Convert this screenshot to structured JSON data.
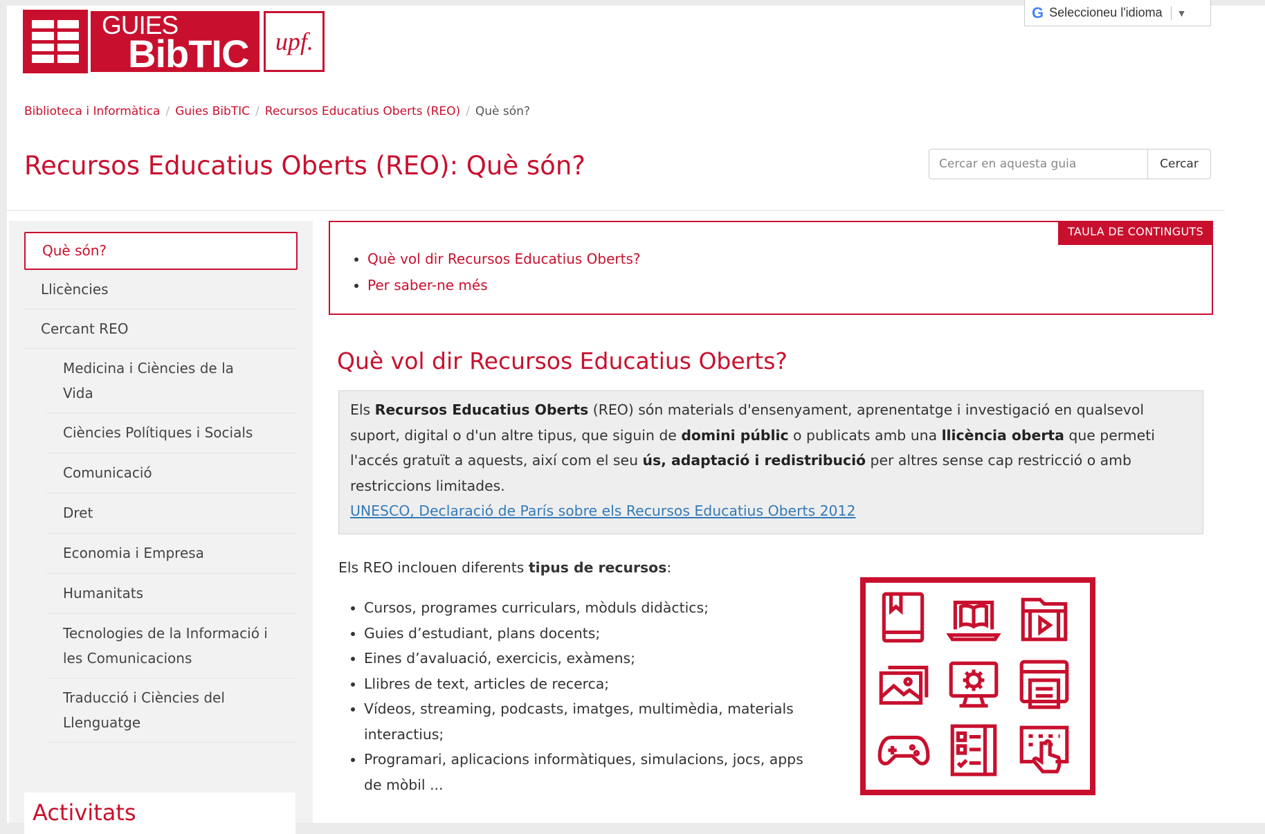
{
  "header": {
    "logo_line1": "GUIES",
    "logo_line2": "BibTIC",
    "logo_upf": "upf.",
    "language_label": "Seleccioneu l'idioma",
    "language_caret": "▼"
  },
  "breadcrumb": [
    {
      "label": "Biblioteca i Informàtica"
    },
    {
      "label": "Guies BibTIC"
    },
    {
      "label": "Recursos Educatius Oberts (REO)"
    },
    {
      "label": "Què són?"
    }
  ],
  "breadcrumb_separator": "/",
  "page_title": "Recursos Educatius Oberts (REO): Què són?",
  "search": {
    "placeholder": "Cercar en aquesta guia",
    "button_label": "Cercar"
  },
  "sidebar": {
    "items": [
      {
        "label": "Què són?"
      },
      {
        "label": "Llicències"
      },
      {
        "label": "Cercant REO"
      }
    ],
    "subitems": [
      {
        "label": "Medicina i Ciències de la Vida"
      },
      {
        "label": "Ciències Polítiques i Socials"
      },
      {
        "label": "Comunicació"
      },
      {
        "label": "Dret"
      },
      {
        "label": "Economia i Empresa"
      },
      {
        "label": "Humanitats"
      },
      {
        "label": "Tecnologies de la Informació i les Comunicacions"
      },
      {
        "label": "Traducció i Ciències del Llenguatge"
      }
    ],
    "activities_title": "Activitats"
  },
  "toc": {
    "label": "TAULA DE CONTINGUTS",
    "items": [
      {
        "label": "Què vol dir Recursos Educatius Oberts?"
      },
      {
        "label": "Per saber-ne més"
      }
    ]
  },
  "section": {
    "heading": "Què vol dir Recursos Educatius Oberts?",
    "quote": {
      "t1": "Els ",
      "b1": "Recursos Educatius Oberts",
      "t2": " (REO) són materials d'ensenyament, aprenentatge i investigació en qualsevol suport, digital o d'un altre tipus, que siguin de ",
      "b2": "domini públic",
      "t3": " o publicats amb una ",
      "b3": "llicència oberta",
      "t4": " que permeti l'accés gratuït a aquests, així com el seu ",
      "b4": "ús, adaptació i redistribució",
      "t5": " per altres sense cap restricció o amb restriccions limitades.",
      "link": "UNESCO, Declaració de París sobre els Recursos Educatius Oberts 2012"
    },
    "intro_text": "Els REO inclouen diferents ",
    "intro_bold": "tipus de recursos",
    "intro_end": ":",
    "types": [
      "Cursos, programes curriculars, mòduls didàctics;",
      "Guies d’estudiant, plans docents;",
      "Eines d’avaluació, exercicis, exàmens;",
      "Llibres de text, articles de recerca;",
      "Vídeos, streaming, podcasts, imatges, multimèdia, materials interactius;",
      "Programari, aplicacions informàtiques, simulacions, jocs, apps de mòbil ..."
    ]
  },
  "colors": {
    "brand_red": "#c8102e",
    "link_blue": "#337ab7"
  },
  "icons": [
    "book-icon",
    "ebook-laptop-icon",
    "video-file-icon",
    "image-icon",
    "monitor-settings-icon",
    "printer-icon",
    "gamepad-icon",
    "checklist-icon",
    "touch-keypad-icon"
  ]
}
